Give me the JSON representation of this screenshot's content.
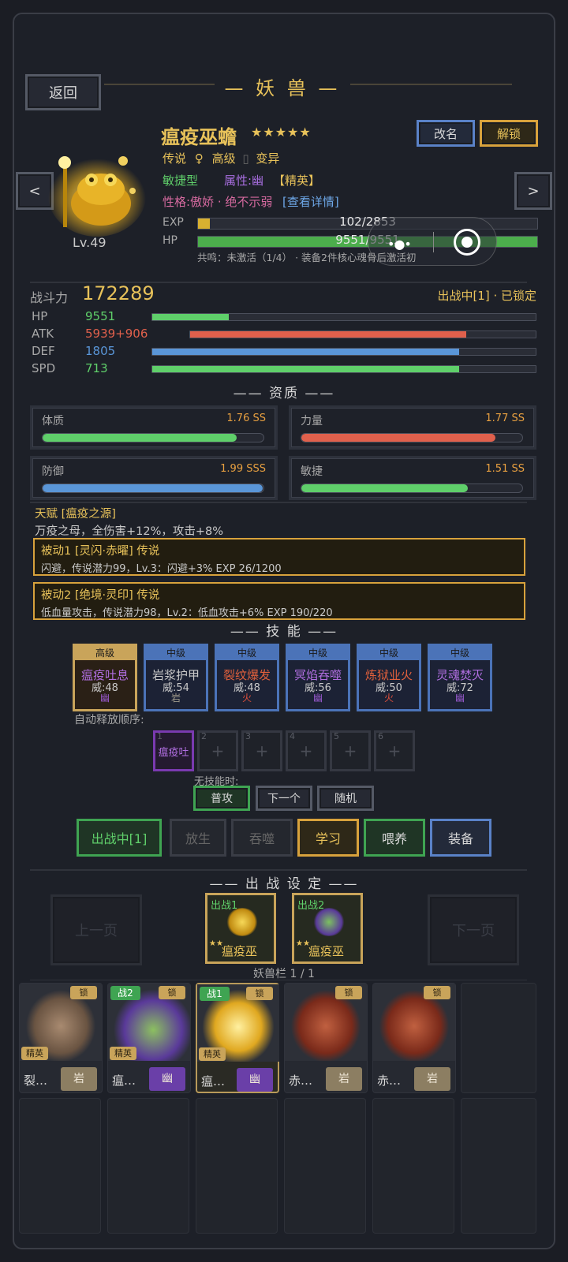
{
  "header": {
    "back_label": "返回",
    "title": "— 妖 兽 —"
  },
  "pet": {
    "name": "瘟疫巫蟾",
    "stars": "★★★★★",
    "rarity": "传说",
    "gender": "♀",
    "grade": "高级",
    "variant": "变异",
    "type": "敏捷型",
    "attribute": "属性:幽",
    "rank": "【精英】",
    "personality": "性格:傲娇 · 绝不示弱",
    "detail_link": "[查看详情]",
    "level": "Lv.49",
    "rename_label": "改名",
    "unlock_label": "解锁",
    "prev_label": "<",
    "next_label": ">"
  },
  "bars": {
    "exp_label": "EXP",
    "exp_text": "102/2853",
    "exp_fraction": 0.036,
    "hp_label": "HP",
    "hp_text": "9551/9551",
    "hp_fraction": 1.0,
    "resonance": "共鸣：未激活（1/4） · 装备2件核心魂骨后激活初"
  },
  "combat": {
    "label": "战斗力",
    "value": "172289",
    "status": "出战中[1] · 已锁定"
  },
  "stats": [
    {
      "label": "HP",
      "value": "9551",
      "color": "#5fcf6a",
      "fraction": 0.2
    },
    {
      "label": "ATK",
      "value": "5939+906",
      "color": "#e0604c",
      "fraction": 0.8
    },
    {
      "label": "DEF",
      "value": "1805",
      "color": "#5a96d8",
      "fraction": 0.8
    },
    {
      "label": "SPD",
      "value": "713",
      "color": "#5fcf6a",
      "fraction": 0.8
    }
  ],
  "aptitude": {
    "title": "—— 资质 ——",
    "items": [
      {
        "label": "体质",
        "value": "1.76 SS",
        "color": "#5fcf6a",
        "fraction": 0.88
      },
      {
        "label": "力量",
        "value": "1.77 SS",
        "color": "#e0604c",
        "fraction": 0.88
      },
      {
        "label": "防御",
        "value": "1.99 SSS",
        "color": "#5a96d8",
        "fraction": 0.995
      },
      {
        "label": "敏捷",
        "value": "1.51 SS",
        "color": "#5fcf6a",
        "fraction": 0.755
      }
    ]
  },
  "talent": {
    "title": "天赋 [瘟疫之源]",
    "desc": "万疫之母，全伤害+12%，攻击+8%"
  },
  "passives": [
    {
      "title": "被动1 [灵闪·赤曜]  传说",
      "desc": "闪避，传说潜力99，Lv.3：闪避+3%  EXP 26/1200"
    },
    {
      "title": "被动2 [绝境·灵印]  传说",
      "desc": "低血量攻击，传说潜力98，Lv.2：低血攻击+6%  EXP 190/220"
    }
  ],
  "skills": {
    "title": "—— 技 能 ——",
    "items": [
      {
        "tier": "高级",
        "name": "瘟疫吐息",
        "power": "威:48",
        "element": "幽",
        "name_color": "#b06ee0",
        "el_color": "#9a5ad0",
        "tier_color": "#c9a45a"
      },
      {
        "tier": "中级",
        "name": "岩浆护甲",
        "power": "威:54",
        "element": "岩",
        "name_color": "#c9c9c9",
        "el_color": "#a09a8a",
        "tier_color": "#4b73b8"
      },
      {
        "tier": "中级",
        "name": "裂纹爆发",
        "power": "威:48",
        "element": "火",
        "name_color": "#e0603c",
        "el_color": "#e0503c",
        "tier_color": "#4b73b8"
      },
      {
        "tier": "中级",
        "name": "冥焰吞噬",
        "power": "威:56",
        "element": "幽",
        "name_color": "#b06ee0",
        "el_color": "#9a5ad0",
        "tier_color": "#4b73b8"
      },
      {
        "tier": "中级",
        "name": "炼狱业火",
        "power": "威:50",
        "element": "火",
        "name_color": "#e0603c",
        "el_color": "#e0503c",
        "tier_color": "#4b73b8"
      },
      {
        "tier": "中级",
        "name": "灵魂焚灭",
        "power": "威:72",
        "element": "幽",
        "name_color": "#b06ee0",
        "el_color": "#9a5ad0",
        "tier_color": "#4b73b8"
      }
    ],
    "auto_label": "自动释放顺序:",
    "slots": [
      {
        "num": "1",
        "text": "瘟疫吐"
      },
      {
        "num": "2",
        "text": "+"
      },
      {
        "num": "3",
        "text": "+"
      },
      {
        "num": "4",
        "text": "+"
      },
      {
        "num": "5",
        "text": "+"
      },
      {
        "num": "6",
        "text": "+"
      }
    ],
    "fallback_label": "无技能时:",
    "fallback_options": [
      "普攻",
      "下一个",
      "随机"
    ]
  },
  "actions": [
    "出战中[1]",
    "放生",
    "吞噬",
    "学习",
    "喂养",
    "装备"
  ],
  "battle": {
    "title": "—— 出 战 设 定 ——",
    "prev_page": "上一页",
    "next_page": "下一页",
    "slots": [
      {
        "tag": "出战1",
        "name": "瘟疫巫",
        "stars": "★★"
      },
      {
        "tag": "出战2",
        "name": "瘟疫巫",
        "stars": "★★"
      }
    ],
    "inventory_label": "妖兽栏 1 / 1"
  },
  "roster": [
    {
      "name": "裂…",
      "type": "岩",
      "lock": "锁",
      "elite": "精英",
      "battle": ""
    },
    {
      "name": "瘟…",
      "type": "幽",
      "lock": "锁",
      "elite": "精英",
      "battle": "战2"
    },
    {
      "name": "瘟…",
      "type": "幽",
      "lock": "锁",
      "elite": "精英",
      "battle": "战1"
    },
    {
      "name": "赤…",
      "type": "岩",
      "lock": "锁",
      "elite": "",
      "battle": ""
    },
    {
      "name": "赤…",
      "type": "岩",
      "lock": "锁",
      "elite": "",
      "battle": ""
    }
  ]
}
